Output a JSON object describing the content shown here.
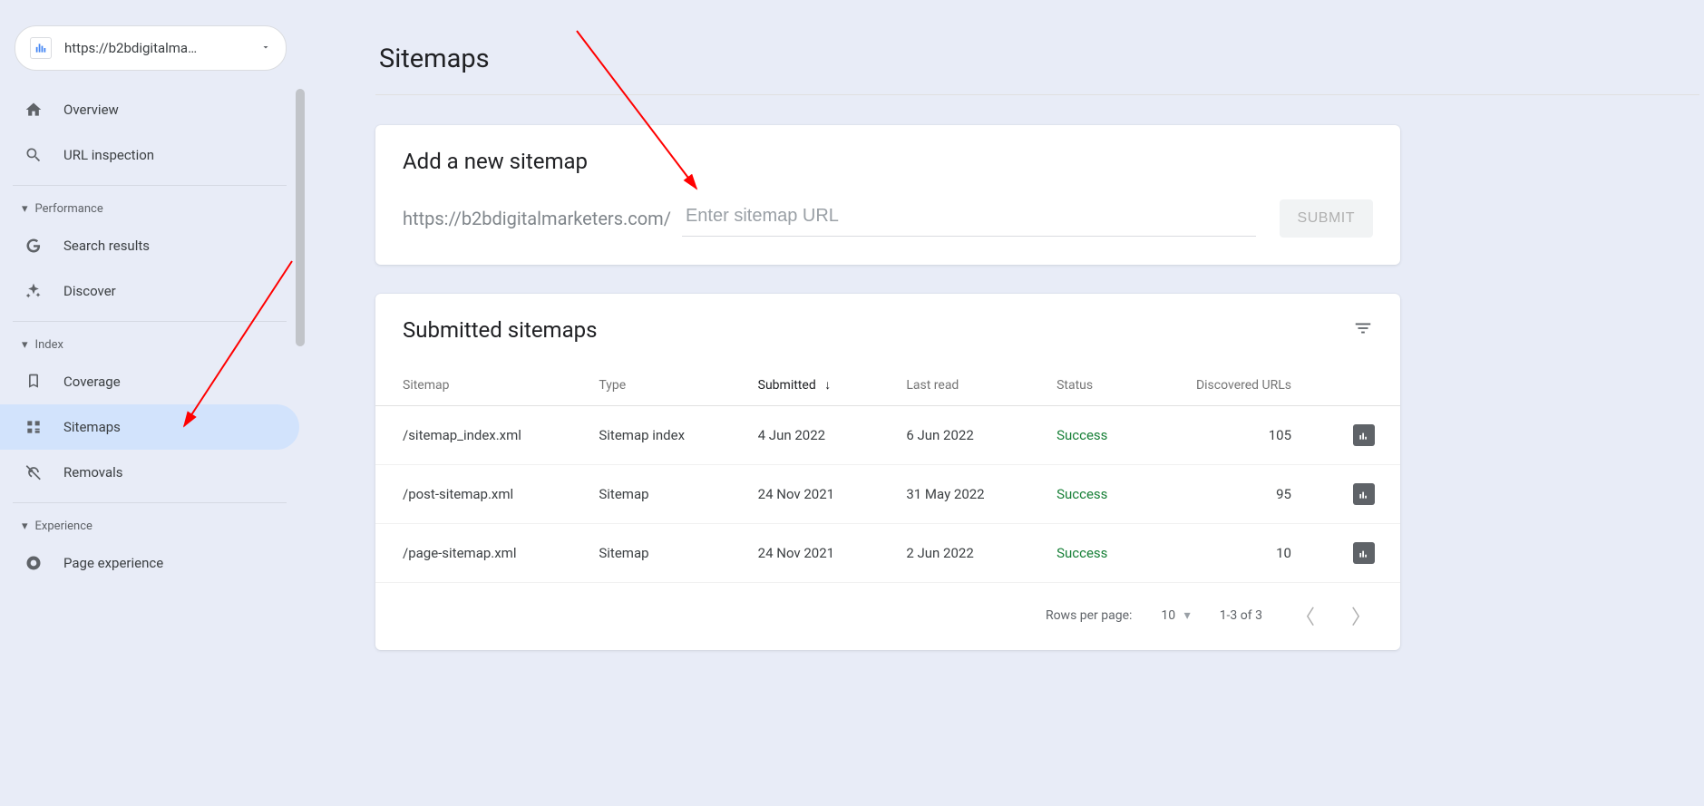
{
  "sitepicker": {
    "label": "https://b2bdigitalma…"
  },
  "sidebar": {
    "top": [
      {
        "label": "Overview"
      },
      {
        "label": "URL inspection"
      }
    ],
    "sections": [
      {
        "title": "Performance",
        "items": [
          {
            "label": "Search results"
          },
          {
            "label": "Discover"
          }
        ]
      },
      {
        "title": "Index",
        "items": [
          {
            "label": "Coverage"
          },
          {
            "label": "Sitemaps",
            "active": true
          },
          {
            "label": "Removals"
          }
        ]
      },
      {
        "title": "Experience",
        "items": [
          {
            "label": "Page experience"
          }
        ]
      }
    ]
  },
  "page": {
    "title": "Sitemaps"
  },
  "add": {
    "title": "Add a new sitemap",
    "prefix": "https://b2bdigitalmarketers.com/",
    "placeholder": "Enter sitemap URL",
    "submit": "SUBMIT"
  },
  "list": {
    "title": "Submitted sitemaps",
    "columns": {
      "sitemap": "Sitemap",
      "type": "Type",
      "submitted": "Submitted",
      "lastread": "Last read",
      "status": "Status",
      "discovered": "Discovered URLs"
    },
    "rows": [
      {
        "sitemap": "/sitemap_index.xml",
        "type": "Sitemap index",
        "submitted": "4 Jun 2022",
        "lastread": "6 Jun 2022",
        "status": "Success",
        "discovered": "105"
      },
      {
        "sitemap": "/post-sitemap.xml",
        "type": "Sitemap",
        "submitted": "24 Nov 2021",
        "lastread": "31 May 2022",
        "status": "Success",
        "discovered": "95"
      },
      {
        "sitemap": "/page-sitemap.xml",
        "type": "Sitemap",
        "submitted": "24 Nov 2021",
        "lastread": "2 Jun 2022",
        "status": "Success",
        "discovered": "10"
      }
    ],
    "footer": {
      "rpp_label": "Rows per page:",
      "rpp_value": "10",
      "range": "1-3 of 3"
    }
  }
}
